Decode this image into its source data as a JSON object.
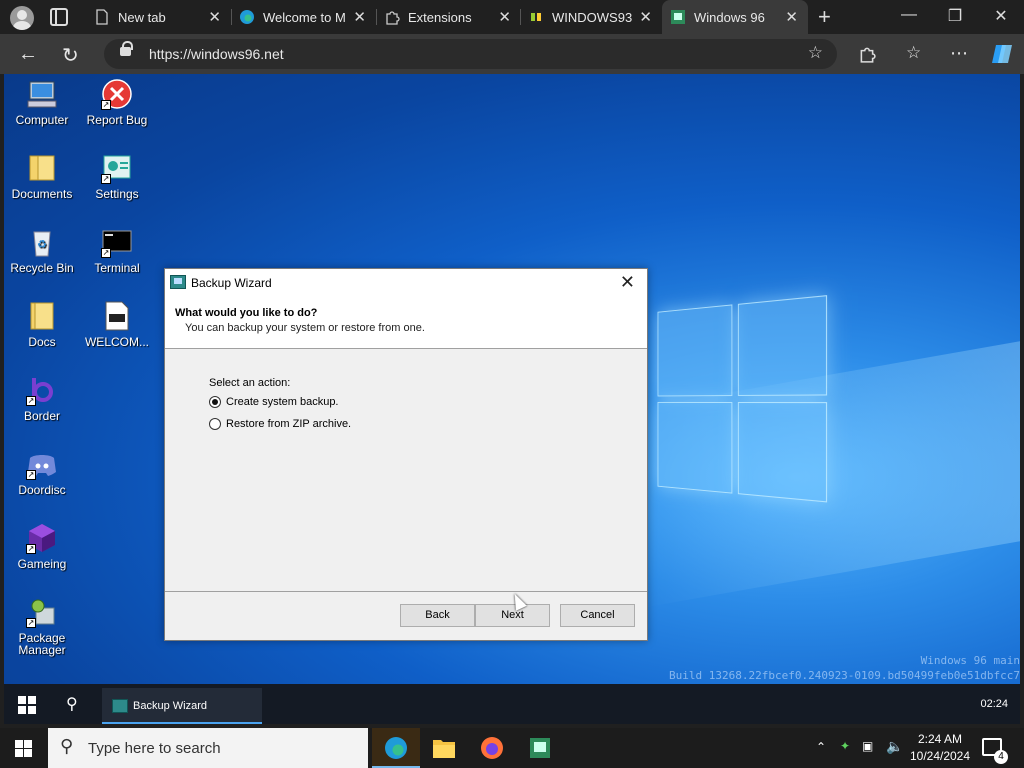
{
  "browser": {
    "tabs": [
      {
        "title": "New tab",
        "icon": "page-icon",
        "active": false
      },
      {
        "title": "Welcome to Mi",
        "icon": "edge-icon",
        "active": false
      },
      {
        "title": "Extensions",
        "icon": "extensions-icon",
        "active": false
      },
      {
        "title": "WINDOWS93",
        "icon": "windows93-icon",
        "active": false
      },
      {
        "title": "Windows 96",
        "icon": "windows96-icon",
        "active": true
      }
    ],
    "url": "https://windows96.net",
    "new_tab_glyph": "+",
    "close_glyph": "✕"
  },
  "desktop": {
    "icons": [
      {
        "label": "Computer"
      },
      {
        "label": "Report Bug"
      },
      {
        "label": "Documents"
      },
      {
        "label": "Settings"
      },
      {
        "label": "Recycle Bin"
      },
      {
        "label": "Terminal"
      },
      {
        "label": "Docs"
      },
      {
        "label": "WELCOM..."
      },
      {
        "label": "Border"
      },
      {
        "label": "Doordisc"
      },
      {
        "label": "Gameing"
      },
      {
        "label": "Package Manager"
      }
    ],
    "build_line1": "Windows 96 main",
    "build_line2": "Build 13268.22fbcef0.240923-0109.bd50499feb0e51dbfcc7"
  },
  "wizard": {
    "title": "Backup Wizard",
    "heading": "What would you like to do?",
    "subheading": "You can backup your system or restore from one.",
    "action_label": "Select an action:",
    "options": [
      {
        "label": "Create system backup.",
        "selected": true
      },
      {
        "label": "Restore from ZIP archive.",
        "selected": false
      }
    ],
    "buttons": {
      "back": "Back",
      "next": "Next",
      "cancel": "Cancel"
    }
  },
  "w96_taskbar": {
    "task_label": "Backup Wizard",
    "clock": "02:24"
  },
  "win_taskbar": {
    "search_placeholder": "Type here to search",
    "time": "2:24 AM",
    "date": "10/24/2024",
    "notification_count": "4"
  }
}
